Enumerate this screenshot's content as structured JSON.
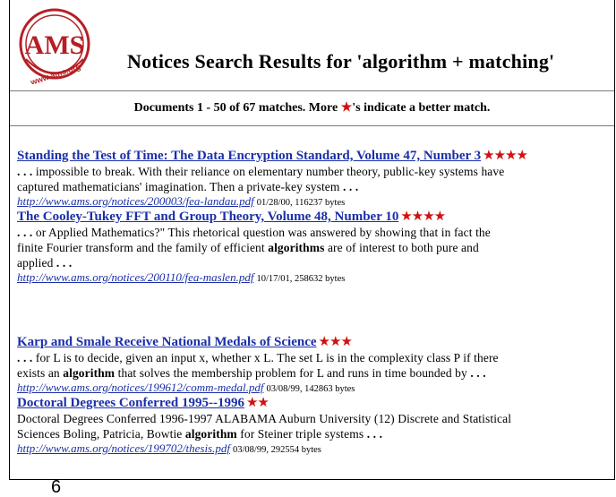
{
  "header": {
    "logo_text": "AMS",
    "logo_url": "www.ams.org",
    "title": "Notices Search Results for 'algorithm + matching'"
  },
  "summary": {
    "prefix": "Documents 1 - 50 of 67 matches. More ",
    "star": "★",
    "suffix": "'s indicate a better match."
  },
  "results": [
    {
      "title": "Standing the Test of Time: The Data Encryption Standard, Volume 47, Number 3",
      "stars": "★★★★",
      "snippet_lines": [
        [
          {
            "t": ". . .",
            "b": true
          },
          {
            "t": " impossible to break. With their reliance on elementary number theory, public-key systems have",
            "b": false
          }
        ],
        [
          {
            "t": "captured mathematicians' imagination. Then a private-key system ",
            "b": false
          },
          {
            "t": ". . .",
            "b": true
          }
        ]
      ],
      "url": "http://www.ams.org/notices/200003/fea-landau.pdf",
      "info": "01/28/00, 116237 bytes"
    },
    {
      "title": "The Cooley-Tukey FFT and Group Theory, Volume 48, Number 10",
      "stars": "★★★★",
      "snippet_lines": [
        [
          {
            "t": ". . .",
            "b": true
          },
          {
            "t": " or Applied Mathematics?\" This rhetorical question was answered by showing that in fact the",
            "b": false
          }
        ],
        [
          {
            "t": "finite Fourier transform and the family of efficient ",
            "b": false
          },
          {
            "t": "algorithms",
            "b": true
          },
          {
            "t": " are of interest to both pure and",
            "b": false
          }
        ],
        [
          {
            "t": "applied ",
            "b": false
          },
          {
            "t": ". . .",
            "b": true
          }
        ]
      ],
      "url": "http://www.ams.org/notices/200110/fea-maslen.pdf",
      "info": "10/17/01, 258632 bytes"
    },
    {
      "title": "Karp and Smale Receive National Medals of Science",
      "stars": "★★★",
      "snippet_lines": [
        [
          {
            "t": ". . .",
            "b": true
          },
          {
            "t": " for L is to decide, given an input x, whether x L. The set L is in the complexity class P if there",
            "b": false
          }
        ],
        [
          {
            "t": "exists an ",
            "b": false
          },
          {
            "t": "algorithm",
            "b": true
          },
          {
            "t": " that solves the membership problem for L and runs in time bounded by ",
            "b": false
          },
          {
            "t": ". . .",
            "b": true
          }
        ]
      ],
      "url": "http://www.ams.org/notices/199612/comm-medal.pdf",
      "info": "03/08/99, 142863 bytes"
    },
    {
      "title": "Doctoral Degrees Conferred 1995--1996",
      "stars": "★★",
      "snippet_lines": [
        [
          {
            "t": "Doctoral Degrees Conferred 1996-1997 ALABAMA Auburn University (12) Discrete and Statistical",
            "b": false
          }
        ],
        [
          {
            "t": "Sciences Boling, Patricia, Bowtie ",
            "b": false
          },
          {
            "t": "algorithm",
            "b": true
          },
          {
            "t": " for Steiner triple systems ",
            "b": false
          },
          {
            "t": ". . .",
            "b": true
          }
        ]
      ],
      "url": "http://www.ams.org/notices/199702/thesis.pdf",
      "info": "03/08/99, 292554 bytes"
    }
  ],
  "page_number": "6",
  "colors": {
    "link": "#1a2fa8",
    "star": "#d01010",
    "logo": "#b51f24"
  }
}
